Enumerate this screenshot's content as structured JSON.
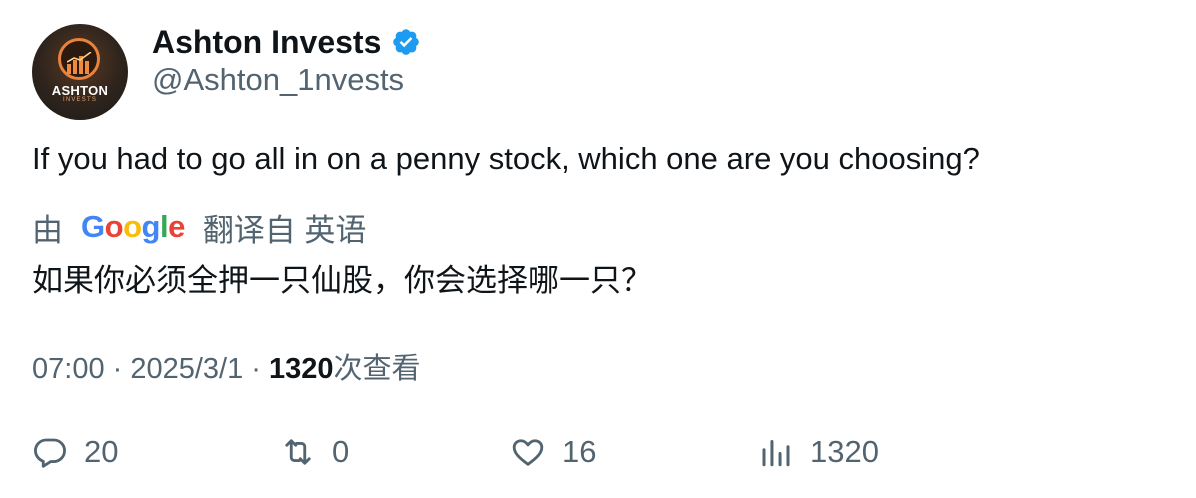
{
  "author": {
    "display_name": "Ashton Invests",
    "handle": "@Ashton_1nvests",
    "avatar_brand": "ASHTON",
    "avatar_sub": "INVESTS",
    "verified_icon": "verified-badge-icon"
  },
  "tweet": {
    "text": "If you had to go all in on a penny stock, which one are you choosing?"
  },
  "translation": {
    "prefix": "由",
    "provider_logo": [
      "G",
      "o",
      "o",
      "g",
      "l",
      "e"
    ],
    "label": "翻译自 英语",
    "text": "如果你必须全押一只仙股，你会选择哪一只？"
  },
  "meta": {
    "time": "07:00",
    "sep1": " · ",
    "date": "2025/3/1",
    "sep2": " · ",
    "views_count": "1320",
    "views_label": "次查看"
  },
  "actions": {
    "replies": {
      "icon": "reply-icon",
      "count": "20"
    },
    "reposts": {
      "icon": "repost-icon",
      "count": "0"
    },
    "likes": {
      "icon": "heart-icon",
      "count": "16"
    },
    "views": {
      "icon": "analytics-icon",
      "count": "1320"
    }
  },
  "colors": {
    "text_primary": "#0f1419",
    "text_secondary": "#536471",
    "verified": "#1d9bf0",
    "avatar_accent": "#e9823a"
  }
}
